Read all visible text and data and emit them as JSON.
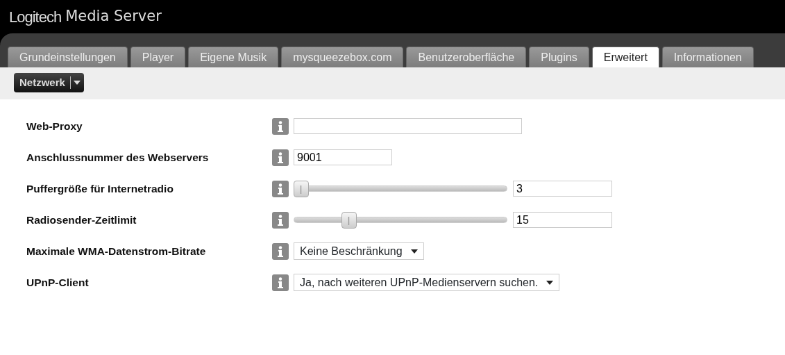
{
  "app_title": {
    "brand": "Logitech",
    "product": "Media Server"
  },
  "tabs": [
    {
      "label": "Grundeinstellungen",
      "selected": false
    },
    {
      "label": "Player",
      "selected": false
    },
    {
      "label": "Eigene Musik",
      "selected": false
    },
    {
      "label": "mysqueezebox.com",
      "selected": false
    },
    {
      "label": "Benutzeroberfläche",
      "selected": false
    },
    {
      "label": "Plugins",
      "selected": false
    },
    {
      "label": "Erweitert",
      "selected": true
    },
    {
      "label": "Informationen",
      "selected": false
    }
  ],
  "section_menu": {
    "label": "Netzwerk"
  },
  "settings": [
    {
      "label": "Web-Proxy",
      "kind": "text"
    },
    {
      "label": "Anschlussnummer des Webservers",
      "kind": "text",
      "value": "9001"
    },
    {
      "label": "Puffergröße für Internetradio",
      "kind": "slider",
      "level": 0,
      "value": "3"
    },
    {
      "label": "Radiosender-Zeitlimit",
      "kind": "slider",
      "level": 0.24,
      "value": "15"
    },
    {
      "label": "Maximale WMA-Datenstrom-Bitrate",
      "kind": "select",
      "value": "Keine Beschränkung"
    },
    {
      "label": "UPnP-Client",
      "kind": "select",
      "value": "Ja, nach weiteren UPnP-Medienservern suchen."
    }
  ]
}
